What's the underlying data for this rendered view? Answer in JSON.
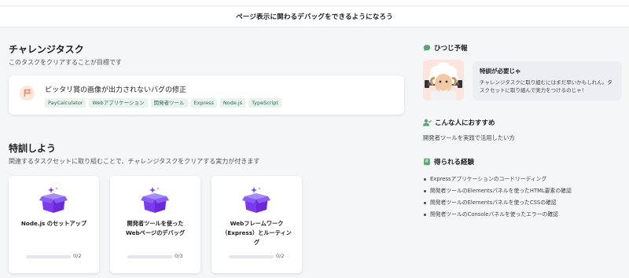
{
  "header": {
    "title": "ページ表示に関わるデバッグをできるようになろう"
  },
  "challenge": {
    "title": "チャレンジタスク",
    "description": "このタスクをクリアすることが目標です",
    "card": {
      "name": "ピッタリ賞の画像が出力されないバグの修正",
      "tags": [
        "PayCalculator",
        "Webアプリケーション",
        "開発者ツール",
        "Express",
        "Node.js",
        "TypeScript"
      ]
    }
  },
  "training": {
    "title": "特訓しよう",
    "description": "関連するタスクセットに取り組むことで、チャレンジタスクをクリアする実力が付きます",
    "tasks": [
      {
        "name": "Node.js のセットアップ",
        "progress_text": "0/2",
        "progress": 0
      },
      {
        "name": "開発者ツールを使った\nWebページのデバッグ",
        "progress_text": "0/3",
        "progress": 0
      },
      {
        "name": "Webフレームワーク\n（Express）とルーティン\nグ",
        "progress_text": "0/2",
        "progress": 0
      }
    ]
  },
  "forecast": {
    "title": "ひつじ予報",
    "bubble_title": "特訓が必要じゃ",
    "bubble_body": "チャレンジタスクに取り組むにはまだ早いかもしれん。タスクセットに取り組んで実力をつけるのじゃ！"
  },
  "recommend": {
    "title": "こんな人におすすめ",
    "text": "開発者ツールを実践で活用したい方"
  },
  "gains": {
    "title": "得られる経験",
    "items": [
      "Expressアプリケーションのコードリーディング",
      "開発者ツールのElementsパネルを使ったHTML要素の確認",
      "開発者ツールのElementsパネルを使ったCSSの確認",
      "開発者ツールのConsoleパネルを使ったエラーの確認"
    ]
  },
  "colors": {
    "accent_purple": "#7c3aed",
    "tag_bg": "#e7f3ec",
    "tag_text": "#2f6b4f",
    "icon_green": "#5aa374"
  }
}
